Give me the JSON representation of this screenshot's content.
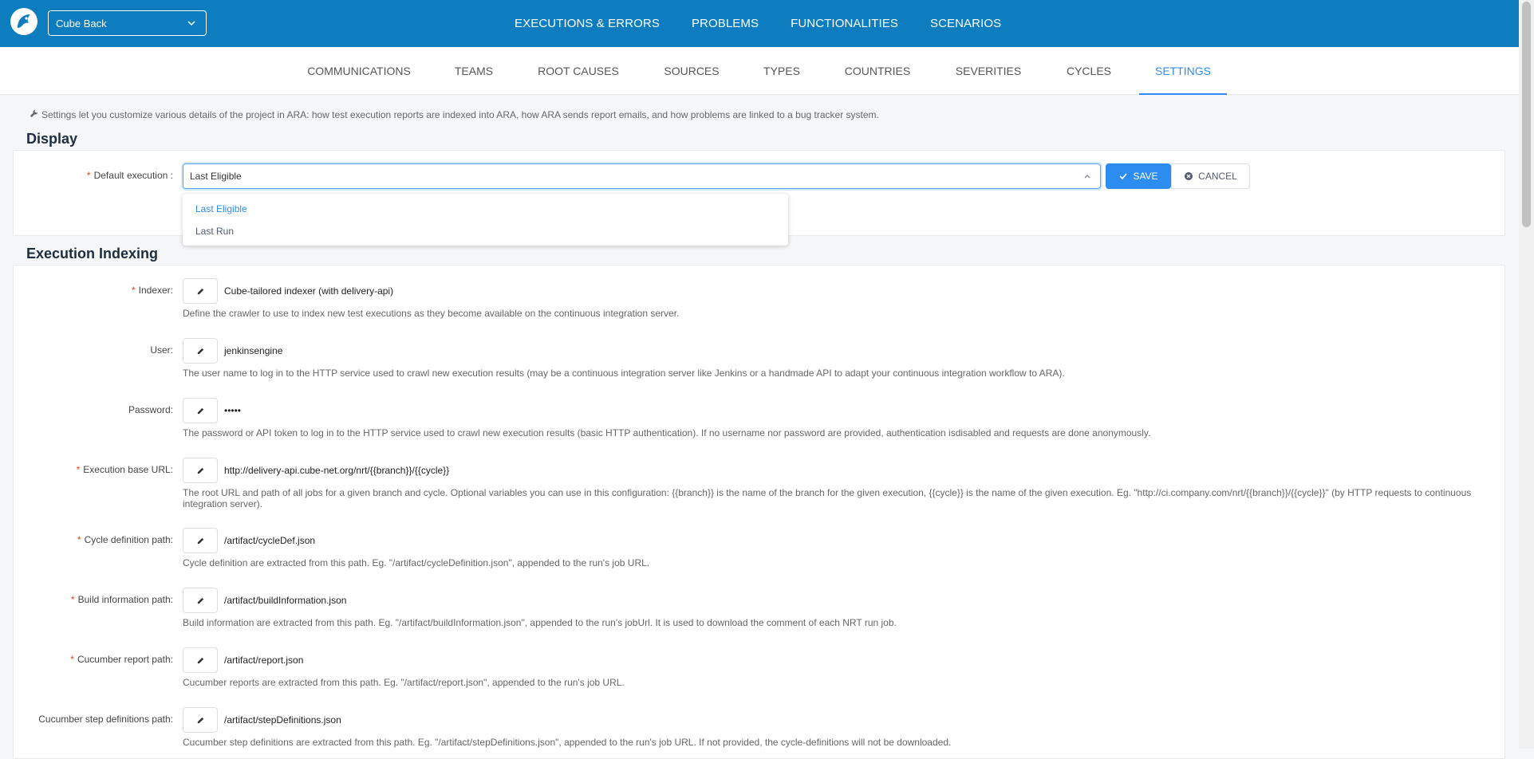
{
  "header": {
    "project": "Cube Back",
    "nav": [
      "EXECUTIONS & ERRORS",
      "PROBLEMS",
      "FUNCTIONALITIES",
      "SCENARIOS"
    ]
  },
  "subnav": {
    "tabs": [
      "COMMUNICATIONS",
      "TEAMS",
      "ROOT CAUSES",
      "SOURCES",
      "TYPES",
      "COUNTRIES",
      "SEVERITIES",
      "CYCLES",
      "SETTINGS"
    ],
    "active": "SETTINGS"
  },
  "info": "Settings let you customize various details of the project in ARA: how test execution reports are indexed into ARA, how ARA sends report emails, and how problems are linked to a bug tracker system.",
  "display": {
    "title": "Display",
    "default_execution_label": "Default execution :",
    "default_execution_value": "Last Eligible",
    "save_label": "SAVE",
    "cancel_label": "CANCEL",
    "options": [
      "Last Eligible",
      "Last Run"
    ]
  },
  "indexing": {
    "title": "Execution Indexing",
    "fields": [
      {
        "label": "Indexer:",
        "required": true,
        "value": "Cube-tailored indexer (with delivery-api)",
        "help": "Define the crawler to use to index new test executions as they become available on the continuous integration server."
      },
      {
        "label": "User:",
        "required": false,
        "value": "jenkinsengine",
        "help": "The user name to log in to the HTTP service used to crawl new execution results (may be a continuous integration server like Jenkins or a handmade API to adapt your continuous integration workflow to ARA)."
      },
      {
        "label": "Password:",
        "required": false,
        "value": "•••••",
        "help": "The password or API token to log in to the HTTP service used to crawl new execution results (basic HTTP authentication). If no username nor password are provided, authentication isdisabled and requests are done anonymously."
      },
      {
        "label": "Execution base URL:",
        "required": true,
        "value": "http://delivery-api.cube-net.org/nrt/{{branch}}/{{cycle}}",
        "help": "The root URL and path of all jobs for a given branch and cycle. Optional variables you can use in this configuration: {{branch}} is the name of the branch for the given execution, {{cycle}} is the name of the given execution. Eg. \"http://ci.company.com/nrt/{{branch}}/{{cycle}}\" (by HTTP requests to continuous integration server)."
      },
      {
        "label": "Cycle definition path:",
        "required": true,
        "value": "/artifact/cycleDef.json",
        "help": "Cycle definition are extracted from this path. Eg. \"/artifact/cycleDefinition.json\", appended to the run's job URL."
      },
      {
        "label": "Build information path:",
        "required": true,
        "value": "/artifact/buildInformation.json",
        "help": "Build information are extracted from this path. Eg. \"/artifact/buildInformation.json\", appended to the run's jobUrl. It is used to download the comment of each NRT run job."
      },
      {
        "label": "Cucumber report path:",
        "required": true,
        "value": "/artifact/report.json",
        "help": "Cucumber reports are extracted from this path. Eg. \"/artifact/report.json\", appended to the run's job URL."
      },
      {
        "label": "Cucumber step definitions path:",
        "required": false,
        "value": "/artifact/stepDefinitions.json",
        "help": "Cucumber step definitions are extracted from this path. Eg. \"/artifact/stepDefinitions.json\", appended to the run's job URL. If not provided, the cycle-definitions will not be downloaded."
      }
    ]
  },
  "colors": {
    "header": "#0d7dbf",
    "accent": "#2d8cf0",
    "required": "#ed4014"
  }
}
